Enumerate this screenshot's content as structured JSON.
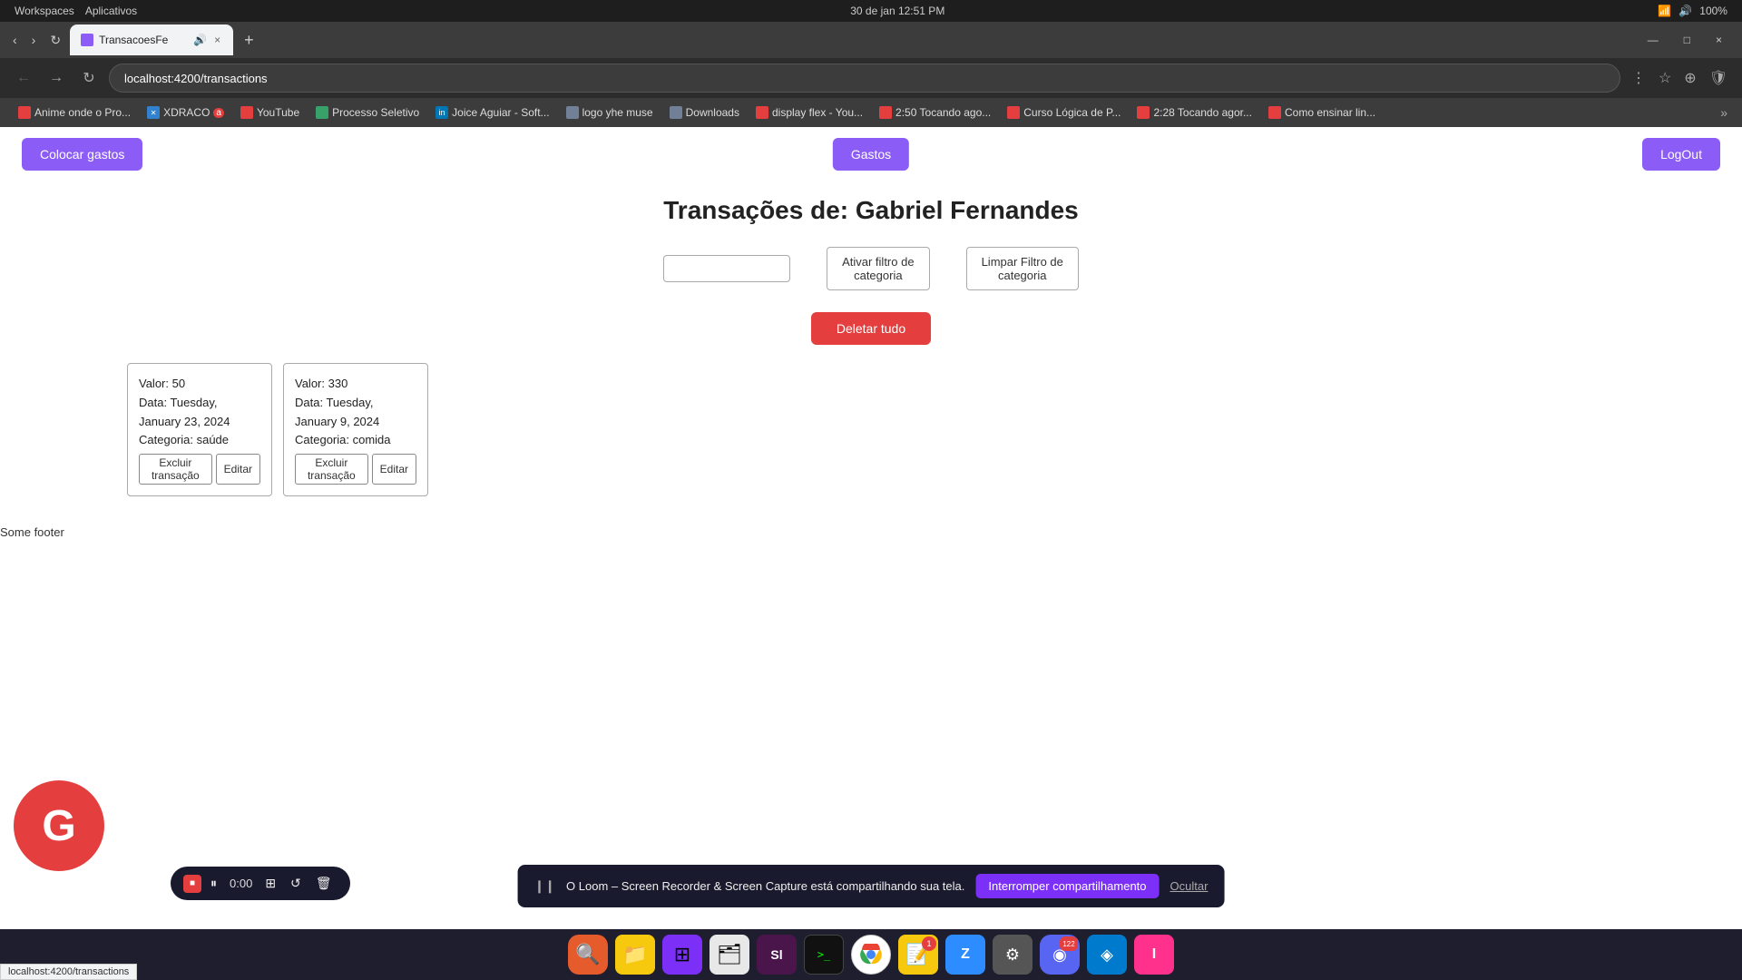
{
  "system_bar": {
    "left": [
      "Workspaces",
      "Aplicativos"
    ],
    "datetime": "30 de jan  12:51 PM",
    "battery": "100%"
  },
  "browser": {
    "tab": {
      "label": "TransacoesFe",
      "audio_icon": "🔊",
      "close_icon": "×"
    },
    "new_tab_icon": "+",
    "address": "localhost:4200/transactions",
    "window": {
      "minimize": "—",
      "maximize": "□",
      "close": "×"
    }
  },
  "bookmarks": [
    {
      "label": "Anime onde o Pro...",
      "color": "red"
    },
    {
      "label": "XDRACO",
      "icon": "✕",
      "color": "blue",
      "badge": "a"
    },
    {
      "label": "YouTube",
      "color": "red"
    },
    {
      "label": "Processo Seletivo",
      "color": "green"
    },
    {
      "label": "Joice Aguiar - Soft...",
      "color": "linkedin"
    },
    {
      "label": "logo yhe muse",
      "color": "gray"
    },
    {
      "label": "Downloads",
      "color": "gray"
    },
    {
      "label": "display flex - You...",
      "color": "red"
    },
    {
      "label": "2:50 Tocando ago...",
      "color": "red"
    },
    {
      "label": "Curso Lógica de P...",
      "color": "red"
    },
    {
      "label": "2:28 Tocando agor...",
      "color": "red"
    },
    {
      "label": "Como ensinar lin...",
      "color": "red"
    }
  ],
  "app": {
    "nav": {
      "colocar_gastos": "Colocar gastos",
      "gastos": "Gastos",
      "logout": "LogOut"
    },
    "title": "Transações de: Gabriel Fernandes",
    "filter": {
      "input_placeholder": "",
      "ativar_filtro": "Ativar filtro de\ncategoria",
      "limpar_filtro": "Limpar Filtro de\ncategoria"
    },
    "delete_all": "Deletar tudo",
    "transactions": [
      {
        "valor": "Valor: 50",
        "data": "Data: Tuesday, January 23, 2024",
        "categoria": "Categoria: saúde",
        "excluir": "Excluir transação",
        "editar": "Editar"
      },
      {
        "valor": "Valor: 330",
        "data": "Data: Tuesday, January 9, 2024",
        "categoria": "Categoria: comida",
        "excluir": "Excluir transação",
        "editar": "Editar"
      }
    ],
    "footer": "Some footer"
  },
  "loom": {
    "recording_controls": {
      "stop_icon": "■",
      "pause_icon": "⏸",
      "time": "0:00",
      "grid_icon": "⊞",
      "replay_icon": "↺",
      "delete_icon": "🗑"
    },
    "notification": "❙❙ O Loom – Screen Recorder & Screen Capture está compartilhando sua tela.",
    "share_btn": "Interromper compartilhamento",
    "hide_btn": "Ocultar"
  },
  "google_avatar": {
    "letter": "G"
  },
  "url_tooltip": "localhost:4200/transactions",
  "taskbar": {
    "icons": [
      {
        "id": "search",
        "symbol": "🔍",
        "bg": "#ff6b35"
      },
      {
        "id": "files",
        "symbol": "📁",
        "bg": "#f6c90e"
      },
      {
        "id": "grid",
        "symbol": "⊞",
        "bg": "#7b2ff7"
      },
      {
        "id": "folder",
        "symbol": "🗂",
        "bg": "#e8e8e8"
      },
      {
        "id": "slack",
        "symbol": "Sl",
        "bg": "#4a154b",
        "color": "#fff"
      },
      {
        "id": "terminal",
        "symbol": ">_",
        "bg": "#111",
        "color": "#0f0"
      },
      {
        "id": "chrome",
        "symbol": "●",
        "bg": "#fff",
        "badge": ""
      },
      {
        "id": "notes",
        "symbol": "📝",
        "bg": "#f6c90e",
        "badge": "1"
      },
      {
        "id": "zoom",
        "symbol": "Z",
        "bg": "#2d8cff",
        "color": "#fff"
      },
      {
        "id": "settings",
        "symbol": "⚙",
        "bg": "#555",
        "color": "#fff"
      },
      {
        "id": "discord",
        "symbol": "◉",
        "bg": "#5865f2",
        "color": "#fff",
        "badge": "122"
      },
      {
        "id": "vscode",
        "symbol": "◈",
        "bg": "#007acc",
        "color": "#fff"
      },
      {
        "id": "idea",
        "symbol": "I",
        "bg": "#ff318c",
        "color": "#fff"
      }
    ]
  }
}
